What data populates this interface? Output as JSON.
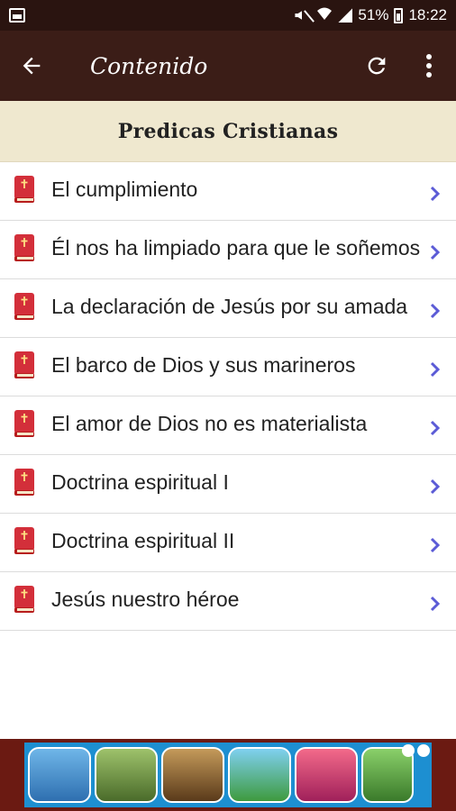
{
  "status_bar": {
    "battery_percent": "51%",
    "time": "18:22",
    "icons": [
      "gallery-icon",
      "mute-icon",
      "wifi-icon",
      "signal-icon",
      "battery-icon"
    ]
  },
  "app_bar": {
    "title": "Contenido",
    "back_icon": "arrow-left-icon",
    "refresh_icon": "refresh-icon",
    "more_icon": "more-vertical-icon"
  },
  "section": {
    "title": "Predicas Cristianas"
  },
  "items": [
    {
      "label": "El cumplimiento"
    },
    {
      "label": "Él nos ha limpiado para que le soñemos"
    },
    {
      "label": "La declaración de Jesús por su amada"
    },
    {
      "label": "El barco de Dios y sus marineros"
    },
    {
      "label": "El amor de Dios no es materialista"
    },
    {
      "label": "Doctrina espiritual I"
    },
    {
      "label": "Doctrina espiritual II"
    },
    {
      "label": "Jesús nuestro héroe"
    }
  ],
  "colors": {
    "status_bar": "#2a1410",
    "app_bar": "#3b1d17",
    "section_header": "#efe8cf",
    "chevron": "#5b5bd6",
    "book": "#d32f3a",
    "ad_frame": "#6b1a12"
  }
}
